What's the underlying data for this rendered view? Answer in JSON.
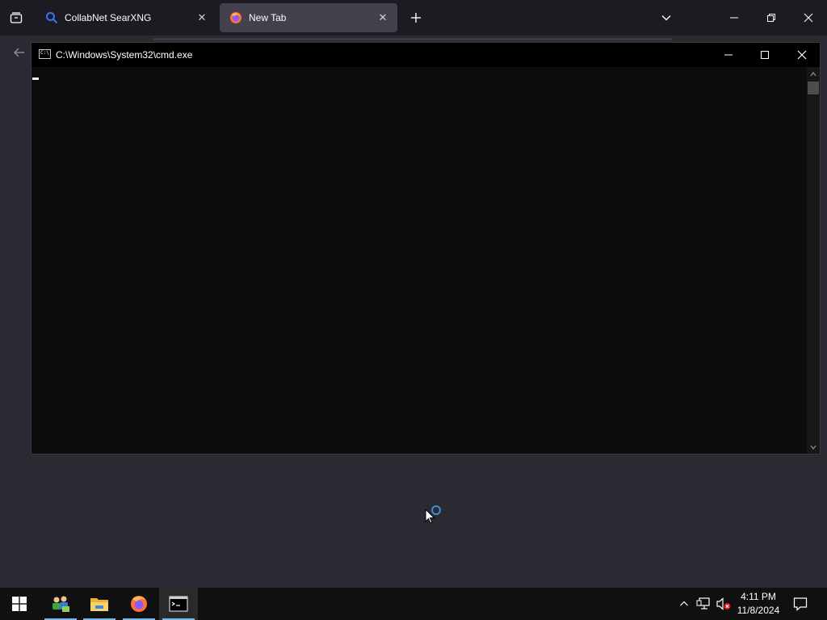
{
  "browser": {
    "tabs": [
      {
        "label": "CollabNet SearXNG",
        "icon": "search-icon",
        "active": false
      },
      {
        "label": "New Tab",
        "icon": "firefox-icon",
        "active": true
      }
    ]
  },
  "cmd": {
    "title": "C:\\Windows\\System32\\cmd.exe",
    "icon_text": "C:\\"
  },
  "taskbar": {
    "apps": [
      "start",
      "network-users",
      "file-explorer",
      "firefox",
      "command-prompt"
    ],
    "active_app": "command-prompt",
    "clock": {
      "time": "4:11 PM",
      "date": "11/8/2024"
    }
  },
  "colors": {
    "accent_blue": "#3a8fd8",
    "taskbar_indicator": "#76b9ed",
    "cmd_background": "#0c0c0c",
    "browser_background": "#2b2a33"
  }
}
